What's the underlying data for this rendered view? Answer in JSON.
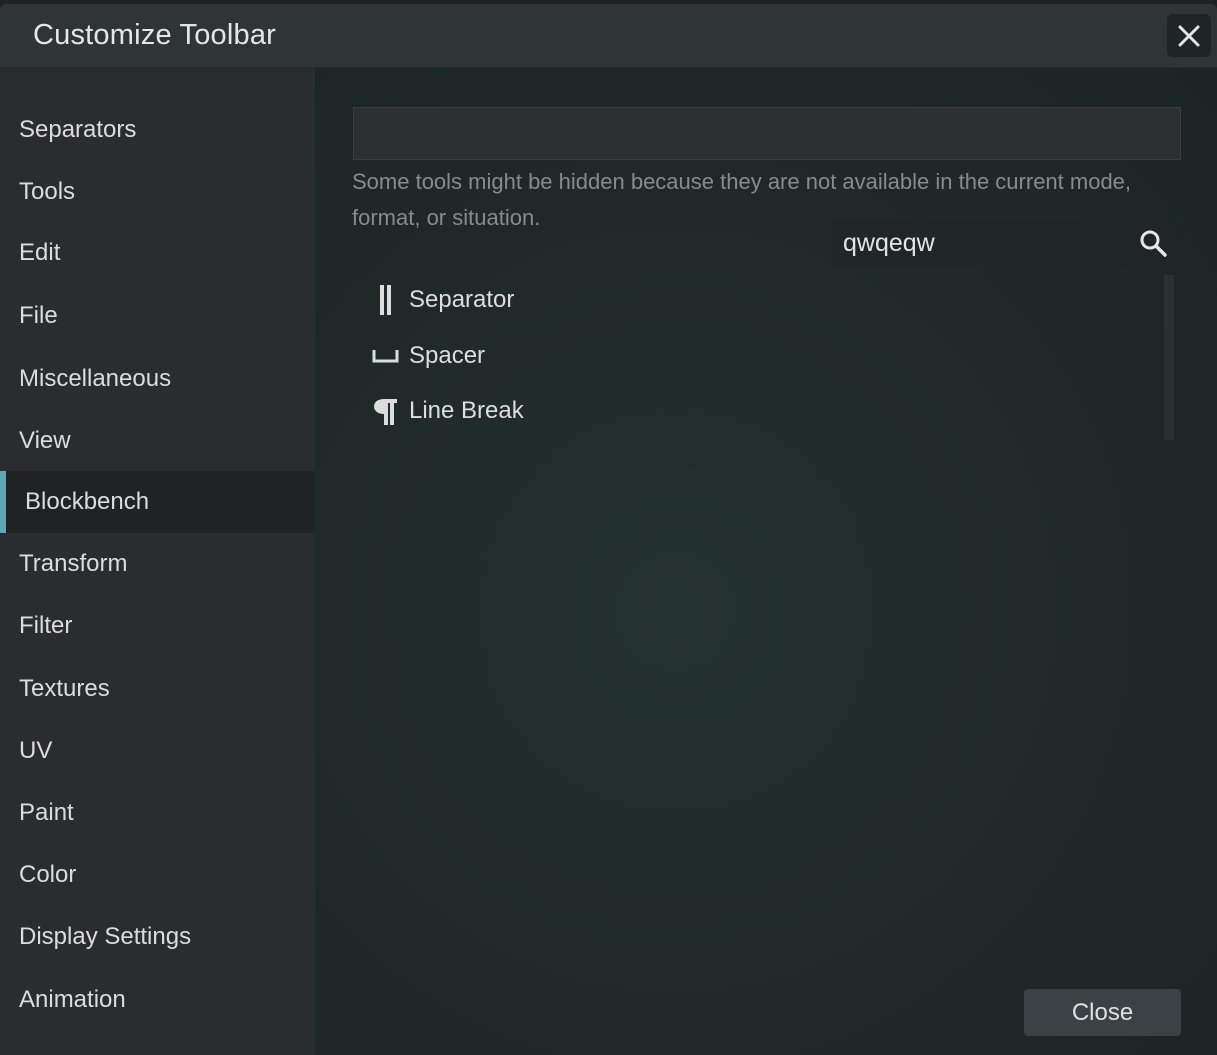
{
  "dialog": {
    "title": "Customize Toolbar",
    "close_icon": "close-icon"
  },
  "sidebar": {
    "items": [
      {
        "label": "Separators",
        "active": false
      },
      {
        "label": "Tools",
        "active": false
      },
      {
        "label": "Edit",
        "active": false
      },
      {
        "label": "File",
        "active": false
      },
      {
        "label": "Miscellaneous",
        "active": false
      },
      {
        "label": "View",
        "active": false
      },
      {
        "label": "Blockbench",
        "active": true
      },
      {
        "label": "Transform",
        "active": false
      },
      {
        "label": "Filter",
        "active": false
      },
      {
        "label": "Textures",
        "active": false
      },
      {
        "label": "UV",
        "active": false
      },
      {
        "label": "Paint",
        "active": false
      },
      {
        "label": "Color",
        "active": false
      },
      {
        "label": "Display Settings",
        "active": false
      },
      {
        "label": "Animation",
        "active": false
      }
    ]
  },
  "main": {
    "hint": "Some tools might be hidden because they are not available in the current mode, format, or situation.",
    "search": {
      "value": "qwqeqw",
      "icon": "search-icon"
    },
    "tools": [
      {
        "label": "Separator",
        "icon": "separator-icon"
      },
      {
        "label": "Spacer",
        "icon": "spacer-icon"
      },
      {
        "label": "Line Break",
        "icon": "pilcrow-icon"
      }
    ],
    "close_button": "Close"
  },
  "colors": {
    "accent": "#5fa9b7",
    "sidebar_bg": "#2a2d2f",
    "titlebar_bg": "#2f3536"
  }
}
